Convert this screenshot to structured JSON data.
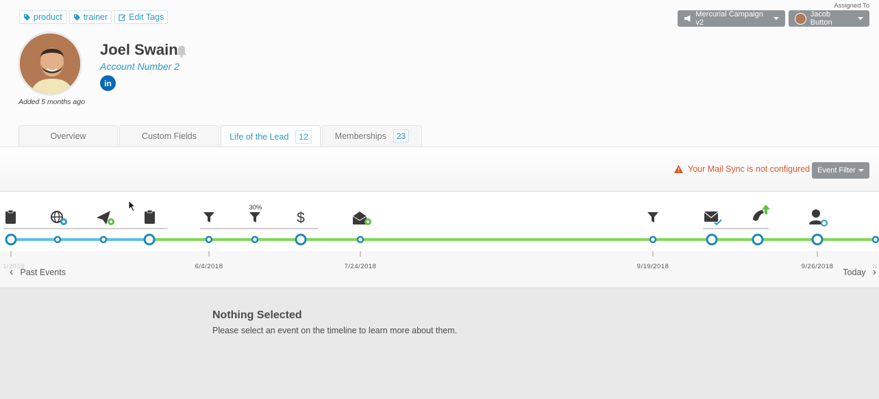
{
  "tags": [
    {
      "label": "product"
    },
    {
      "label": "trainer"
    }
  ],
  "edit_tags_label": "Edit Tags",
  "profile": {
    "name": "Joel Swain",
    "account": "Account Number 2",
    "added": "Added 5 months ago",
    "linkedin_text": "in"
  },
  "assigned": {
    "label": "Assigned To",
    "campaign": "Mercurial Campaign v2",
    "user": "Jacob Button"
  },
  "tabs": [
    {
      "label": "Overview",
      "count": ""
    },
    {
      "label": "Custom Fields",
      "count": ""
    },
    {
      "label": "Life of the Lead",
      "count": "12",
      "active": true
    },
    {
      "label": "Memberships",
      "count": "23"
    }
  ],
  "alert": {
    "text": "Your Mail Sync is not configured"
  },
  "event_filter_label": "Event Filter",
  "timeline": {
    "percent_label": "30%",
    "dates": [
      "1/2018",
      "6/4/2018",
      "7/24/2018",
      "9/19/2018",
      "9/26/2018",
      "N"
    ],
    "past_label": "Past Events",
    "today_label": "Today",
    "icons": [
      "clipboard-icon",
      "globe-gear-icon",
      "paper-plane-gear-icon",
      "clipboard-icon",
      "funnel-icon",
      "funnel-icon",
      "dollar-icon",
      "envelope-open-gear-icon",
      "funnel-icon",
      "envelope-check-icon",
      "phone-up-icon",
      "user-sync-icon"
    ]
  },
  "detail": {
    "title": "Nothing Selected",
    "subtitle": "Please select an event on the timeline to learn more about them."
  },
  "colors": {
    "accent": "#2a9ac9",
    "timeline_green": "#7ed957",
    "timeline_blue": "#5bc0eb",
    "alert": "#e0562a"
  }
}
